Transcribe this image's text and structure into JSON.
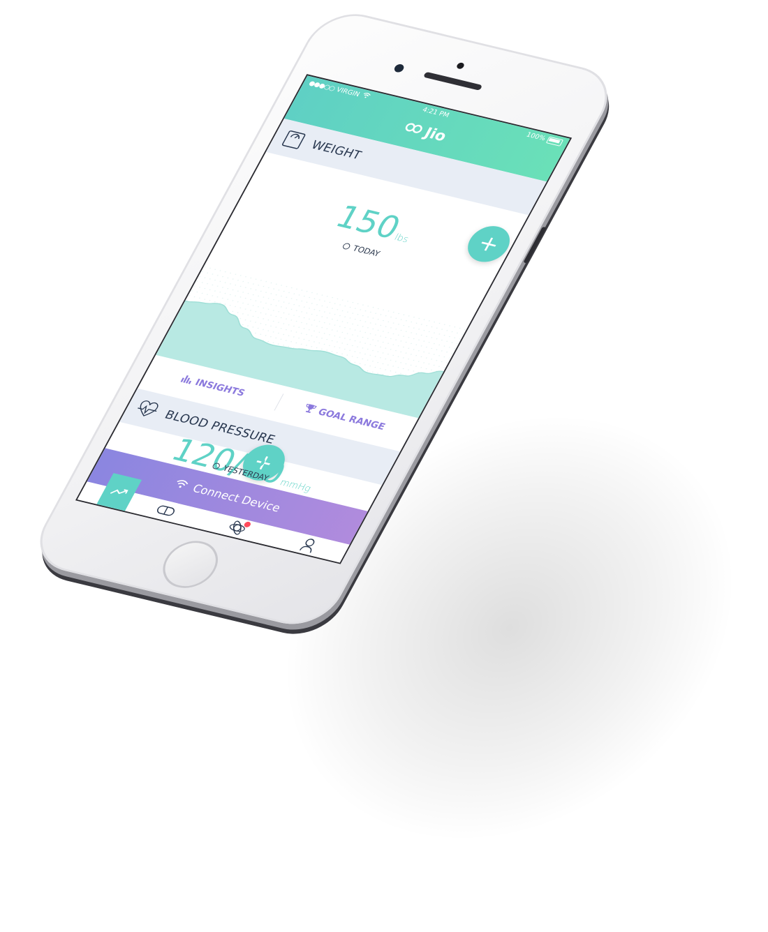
{
  "status_bar": {
    "signal": "●●●○○",
    "carrier": "VIRGIN",
    "wifi_icon": "wifi-icon",
    "time": "4:21 PM",
    "battery": "100%"
  },
  "header": {
    "brand": "Jio"
  },
  "weight_card": {
    "title": "WEIGHT",
    "icon": "scale-icon",
    "value": "150",
    "unit": "lbs",
    "when": "TODAY",
    "add_label": "+"
  },
  "weight_trend": {
    "type": "area",
    "note": "unlabeled weight trend curve, no axes printed",
    "values": [
      0.56,
      0.6,
      0.65,
      0.52,
      0.35,
      0.22,
      0.18,
      0.2,
      0.24,
      0.28,
      0.26,
      0.18,
      0.1,
      0.12,
      0.2,
      0.32,
      0.42
    ]
  },
  "actions": {
    "insights": "INSIGHTS",
    "goal_range": "GOAL RANGE"
  },
  "bp_card": {
    "title": "BLOOD PRESSURE",
    "icon": "heart-pulse-icon",
    "value": "120/80",
    "unit": "mmHg",
    "when": "YESTERDAY",
    "add_label": "+"
  },
  "connect": {
    "label": "Connect Device",
    "icon": "wifi-icon"
  },
  "tabs": [
    {
      "name": "trends",
      "icon": "trend-icon",
      "active": true
    },
    {
      "name": "medication",
      "icon": "pill-icon",
      "active": false
    },
    {
      "name": "community",
      "icon": "orbit-icon",
      "active": false,
      "badge": true
    },
    {
      "name": "profile",
      "icon": "person-icon",
      "active": false
    }
  ],
  "colors": {
    "accent": "#5fd2c6",
    "header_start": "#5fd0c4",
    "header_end": "#6ae0b8",
    "purple_text": "#8b79dd",
    "connect_start": "#8b86e0",
    "connect_end": "#b08bdd",
    "section_bg": "#e8edf5",
    "badge": "#ff4b5c"
  }
}
